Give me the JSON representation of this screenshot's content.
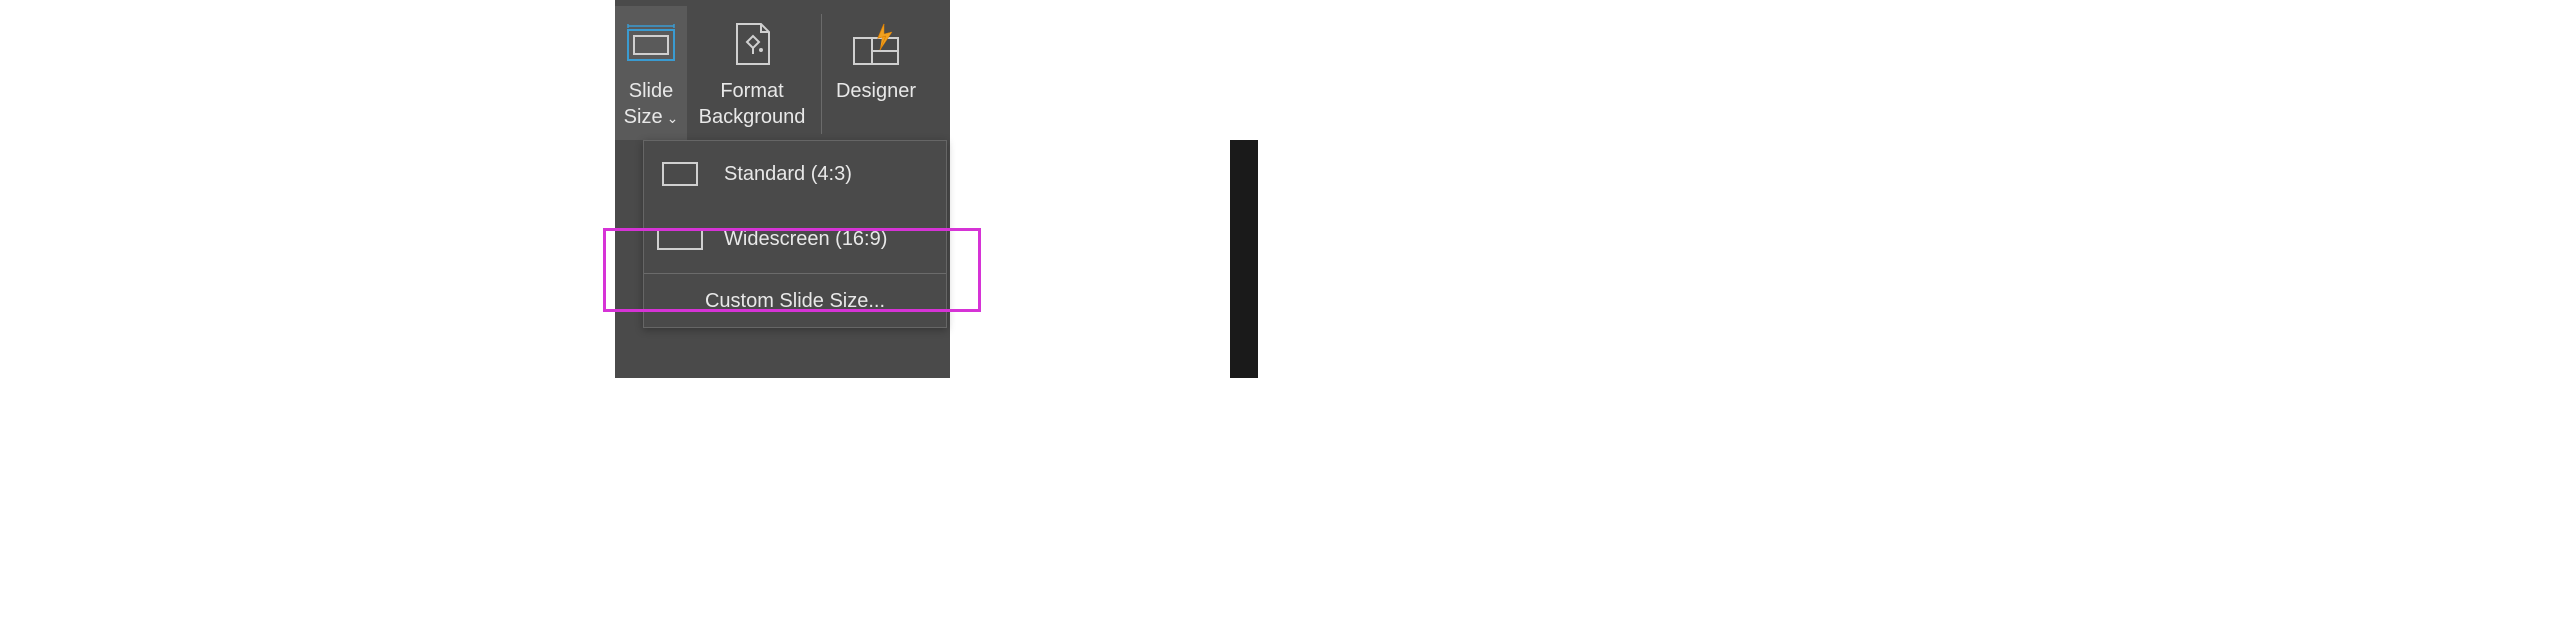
{
  "ribbon": {
    "slide_size": {
      "line1": "Slide",
      "line2": "Size"
    },
    "format_bg": {
      "line1": "Format",
      "line2": "Background"
    },
    "designer": "Designer"
  },
  "menu": {
    "standard": "Standard (4:3)",
    "widescreen": "Widescreen (16:9)",
    "custom_prefix": "C",
    "custom_rest": "ustom Slide Size..."
  },
  "colors": {
    "highlight": "#d633d6"
  }
}
